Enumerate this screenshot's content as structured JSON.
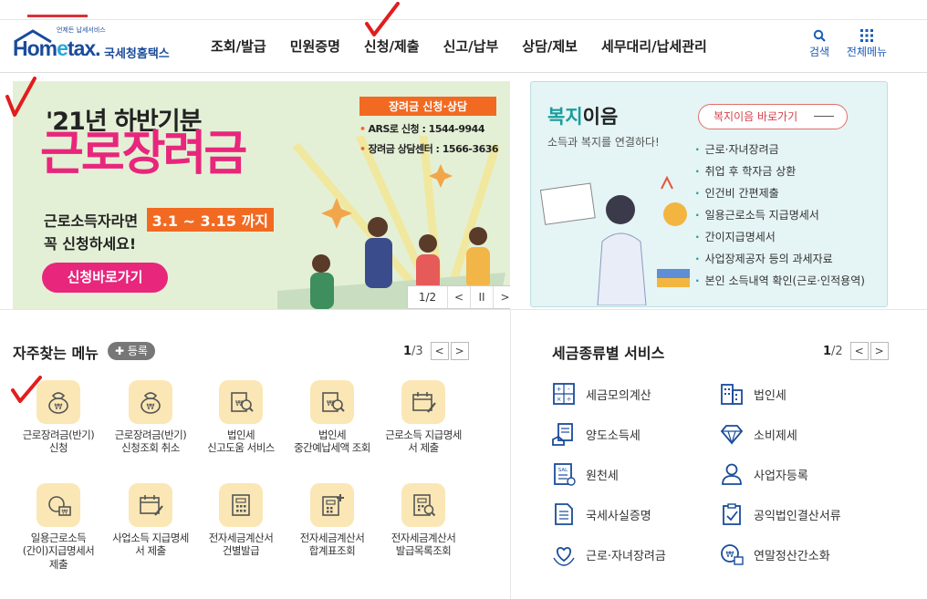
{
  "header": {
    "logo_tagline": "언제든 납세서비스",
    "logo_text": "Hometax",
    "logo_korean": "국세청홈택스",
    "nav": [
      "조회/발급",
      "민원증명",
      "신청/제출",
      "신고/납부",
      "상담/제보",
      "세무대리/납세관리"
    ],
    "search_label": "검색",
    "allmenu_label": "전체메뉴"
  },
  "banner": {
    "year_line": "'21년 하반기분",
    "main_title": "근로장려금",
    "sub1": "근로소득자라면",
    "date_range": "3.1 ~ 3.15 까지",
    "sub2": "꼭 신청하세요!",
    "button_label": "신청바로가기",
    "box_title": "장려금 신청·상담",
    "box_line1": "ARS로 신청 : 1544-9944",
    "box_line2": "장려금 상담센터 : 1566-3636",
    "page_indicator": "1/2",
    "prev_label": "<",
    "pause_label": "II",
    "next_label": ">"
  },
  "welfare": {
    "title_accent": "복지",
    "title_rest": "이음",
    "subtitle": "소득과 복지를 연결하다!",
    "button_label": "복지이음 바로가기",
    "items": [
      "근로·자녀장려금",
      "취업 후 학자금 상환",
      "인건비 간편제출",
      "일용근로소득 지급명세서",
      "간이지급명세서",
      "사업장제공자 등의 과세자료",
      "본인 소득내역 확인(근로·인적용역)"
    ]
  },
  "frequent": {
    "title": "자주찾는 메뉴",
    "register_label": "등록",
    "page_current": "1",
    "page_total": "/3",
    "items": [
      {
        "line1": "근로장려금(반기)",
        "line2": "신청",
        "icon": "money-bag-icon"
      },
      {
        "line1": "근로장려금(반기)",
        "line2": "신청조회 취소",
        "icon": "money-bag-icon"
      },
      {
        "line1": "법인세",
        "line2": "신고도움 서비스",
        "icon": "document-search-icon"
      },
      {
        "line1": "법인세",
        "line2": "중간예납세액 조회",
        "icon": "document-search-icon"
      },
      {
        "line1": "근로소득 지급명세",
        "line2": "서 제출",
        "icon": "calendar-edit-icon"
      },
      {
        "line1": "일용근로소득",
        "line2": "(간이)지급명세서",
        "line3": "제출",
        "icon": "coin-money-icon"
      },
      {
        "line1": "사업소득 지급명세",
        "line2": "서 제출",
        "icon": "calendar-edit-icon"
      },
      {
        "line1": "전자세금계산서",
        "line2": "건별발급",
        "icon": "calculator-doc-icon"
      },
      {
        "line1": "전자세금계산서",
        "line2": "합계표조회",
        "icon": "calculator-plus-icon"
      },
      {
        "line1": "전자세금계산서",
        "line2": "발급목록조회",
        "icon": "calculator-search-icon"
      }
    ]
  },
  "tax_services": {
    "title": "세금종류별 서비스",
    "page_current": "1",
    "page_total": "/2",
    "items": [
      {
        "label": "세금모의계산",
        "icon": "calculator-icon"
      },
      {
        "label": "법인세",
        "icon": "building-icon"
      },
      {
        "label": "양도소득세",
        "icon": "document-hand-icon"
      },
      {
        "label": "소비제세",
        "icon": "diamond-icon"
      },
      {
        "label": "원천세",
        "icon": "salary-doc-icon"
      },
      {
        "label": "사업자등록",
        "icon": "person-icon"
      },
      {
        "label": "국세사실증명",
        "icon": "certificate-icon"
      },
      {
        "label": "공익법인결산서류",
        "icon": "clipboard-check-icon"
      },
      {
        "label": "근로·자녀장려금",
        "icon": "heart-hands-icon"
      },
      {
        "label": "연말정산간소화",
        "icon": "won-person-icon"
      }
    ]
  },
  "colors": {
    "brand_blue": "#1a4b9b",
    "banner_pink": "#e8267c",
    "banner_orange": "#f26a21",
    "welfare_teal": "#1a9d9d",
    "icon_bg": "#fbe7b5"
  }
}
